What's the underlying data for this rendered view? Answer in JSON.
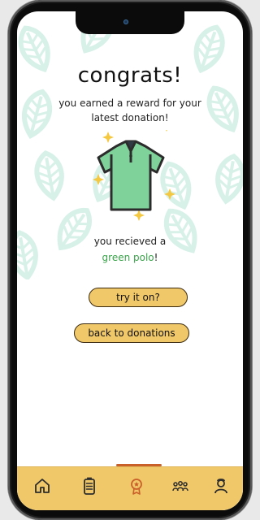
{
  "reward": {
    "title": "congrats!",
    "subtitle": "you earned a reward for your latest donation!",
    "received_text": "you recieved a",
    "item_name": "green polo",
    "item_suffix": "!",
    "item_icon": "polo-shirt-icon"
  },
  "actions": {
    "try_label": "try it on?",
    "back_label": "back to donations"
  },
  "nav": {
    "items": [
      {
        "name": "home",
        "icon": "home-icon"
      },
      {
        "name": "donations",
        "icon": "clipboard-icon"
      },
      {
        "name": "rewards",
        "icon": "reward-badge-icon",
        "active": true
      },
      {
        "name": "community",
        "icon": "people-icon"
      },
      {
        "name": "profile",
        "icon": "user-icon"
      }
    ]
  },
  "colors": {
    "accent_yellow": "#f0c86a",
    "prize_green": "#3aa34a",
    "nav_active": "#c9602a",
    "leaf_pattern": "#cfeee4"
  }
}
